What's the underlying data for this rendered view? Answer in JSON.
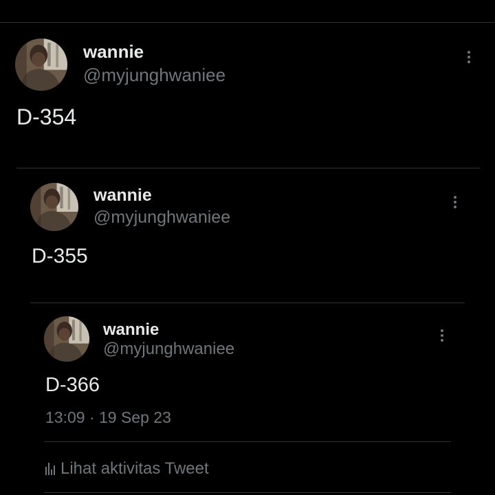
{
  "colors": {
    "background": "#000000",
    "text_primary": "#e7e9ea",
    "text_secondary": "#71767b",
    "divider": "#2f3336"
  },
  "tweets": [
    {
      "display_name": "wannie",
      "handle": "@myjunghwaniee",
      "text": "D-354",
      "avatar_icon": "profile-avatar",
      "more_icon": "more-vertical-icon"
    },
    {
      "display_name": "wannie",
      "handle": "@myjunghwaniee",
      "text": "D-355",
      "avatar_icon": "profile-avatar",
      "more_icon": "more-vertical-icon"
    },
    {
      "display_name": "wannie",
      "handle": "@myjunghwaniee",
      "text": "D-366",
      "timestamp": "13:09 · 19 Sep 23",
      "avatar_icon": "profile-avatar",
      "more_icon": "more-vertical-icon",
      "activity": {
        "icon": "analytics-bars-icon",
        "label": "Lihat aktivitas Tweet"
      }
    }
  ]
}
